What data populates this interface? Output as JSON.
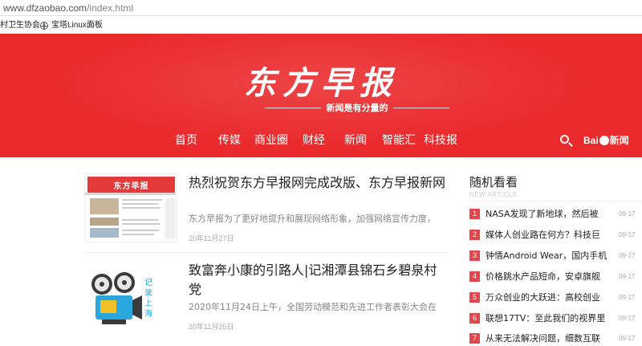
{
  "browser": {
    "url_host": "www.dfzaobao.com",
    "url_path": "/index.html",
    "bookmarks": [
      "村卫生协会",
      "宝塔Linux面板"
    ]
  },
  "header": {
    "logo_text": "东方早报",
    "slogan": "新闻是有分量的",
    "nav": [
      "首页",
      "传媒",
      "商业圈",
      "财经",
      "新闻",
      "智能汇",
      "科技报"
    ],
    "baidu_logo_text": "Bai",
    "baidu_news_text": "新闻",
    "accent_color": "#ea2a2d"
  },
  "articles": [
    {
      "title": "热烈祝贺东方早报网完成改版、东方早报新网",
      "desc": "东方早报为了更好地提升和展现网络形象，加强网络宣传力度，",
      "date": "20年11月27日",
      "thumb_logo": "东方早报"
    },
    {
      "title": "致富奔小康的引路人|记湘潭县锦石乡碧泉村党",
      "desc": "2020年11月24日上午，全国劳动模范和先进工作者表彰大会在",
      "date": "20年11月26日",
      "thumb_caption": "记录上海"
    }
  ],
  "sidebar": {
    "title": "随机看看",
    "subtitle": "NEW ARTICLE",
    "items": [
      {
        "num": "1",
        "text": "NASA发现了新地球，然后被",
        "date": "09-17"
      },
      {
        "num": "2",
        "text": "媒体人创业路在何方？科技巨",
        "date": "09-17"
      },
      {
        "num": "3",
        "text": "钟情Android Wear，国内手机",
        "date": "09-17"
      },
      {
        "num": "4",
        "text": "价格跳水产品短命，安卓旗舰",
        "date": "09-17"
      },
      {
        "num": "5",
        "text": "万众创业的大跃进：高校创业",
        "date": "09-17"
      },
      {
        "num": "6",
        "text": "联想17TV：至此我们的视界里",
        "date": "09-17"
      },
      {
        "num": "7",
        "text": "从来无法解决问题，细数互联",
        "date": "09-17"
      }
    ]
  }
}
